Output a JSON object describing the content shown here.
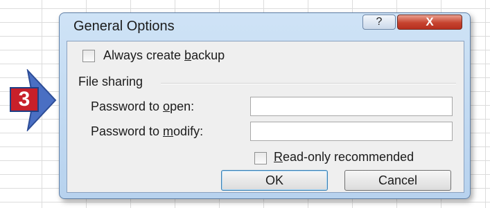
{
  "step": {
    "number": "3"
  },
  "dialog": {
    "title": "General Options",
    "help_glyph": "?",
    "close_glyph": "X",
    "backup": {
      "before": "Always create ",
      "underline": "b",
      "after": "ackup",
      "checked": false
    },
    "file_sharing_label": "File sharing",
    "password_open": {
      "before": "Password to ",
      "underline": "o",
      "after": "pen:",
      "value": ""
    },
    "password_modify": {
      "before": "Password to ",
      "underline": "m",
      "after": "odify:",
      "value": ""
    },
    "read_only": {
      "underline": "R",
      "after": "ead-only recommended",
      "checked": false
    },
    "ok_label": "OK",
    "cancel_label": "Cancel"
  },
  "colors": {
    "badge": "#c8202a",
    "arrow": "#4a6fc3",
    "close_button": "#c6432f",
    "dialog_frame": "#b7d2ee"
  },
  "icons": {
    "arrow": "right-arrow-icon",
    "help": "help-icon",
    "close": "close-icon"
  }
}
